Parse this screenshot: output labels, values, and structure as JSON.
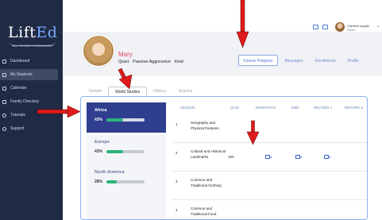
{
  "app": {
    "logo_main": "Lift",
    "logo_accent": "Ed",
    "logo_tagline": "ALL THINGS PARAMOUNT"
  },
  "sidebar": {
    "items": [
      {
        "label": "Dashboard",
        "icon": "grid-icon",
        "active": false
      },
      {
        "label": "My Students",
        "icon": "students-icon",
        "active": true
      },
      {
        "label": "Calendar",
        "icon": "calendar-icon",
        "active": false
      },
      {
        "label": "Family Directory",
        "icon": "family-icon",
        "active": false
      },
      {
        "label": "Tutorials",
        "icon": "info-icon",
        "active": false
      },
      {
        "label": "Support",
        "icon": "support-icon",
        "active": false
      }
    ]
  },
  "topbar": {
    "user_name": "Caroline Ingalls",
    "user_role": "Parent",
    "icons": [
      "chat-icon",
      "book-icon"
    ]
  },
  "student": {
    "name": "Mary",
    "traits": [
      "Quiet",
      "Passive Aggressive",
      "Kind"
    ]
  },
  "profile_tabs": [
    {
      "label": "Course Progress",
      "active": true
    },
    {
      "label": "Messages",
      "active": false
    },
    {
      "label": "Enrollments",
      "active": false
    },
    {
      "label": "Profile",
      "active": false
    }
  ],
  "subject_tabs": [
    {
      "label": "Growth",
      "active": false
    },
    {
      "label": "World Studies",
      "active": true
    },
    {
      "label": "History",
      "active": false
    },
    {
      "label": "Science",
      "active": false
    }
  ],
  "regions": [
    {
      "name": "Africa",
      "percent_label": "43%",
      "progress": 0.43,
      "active": true
    },
    {
      "name": "Europe",
      "percent_label": "43%",
      "progress": 0.43,
      "active": false
    },
    {
      "name": "North America",
      "percent_label": "28%",
      "progress": 0.28,
      "active": false
    }
  ],
  "lesson_table": {
    "headers": {
      "lesson": "LESSON",
      "quiz": "QUIZ",
      "research": "RESEARCH",
      "rr": "R&R",
      "record1": "RECORD 1",
      "record2": "RECORD 2"
    },
    "rows": [
      {
        "num": "1",
        "lesson": "Geography and Physical Features",
        "quiz": "",
        "research": false,
        "rr": false,
        "record1": false
      },
      {
        "num": "2",
        "lesson": "Cultural and Historical Landmarks",
        "quiz": "100",
        "research": true,
        "rr": true,
        "record1": true
      },
      {
        "num": "3",
        "lesson": "Common and Traditional Clothing",
        "quiz": "",
        "research": false,
        "rr": false,
        "record1": false
      },
      {
        "num": "4",
        "lesson": "Common and Traditional Food",
        "quiz": "",
        "research": false,
        "rr": false,
        "record1": false
      }
    ]
  },
  "colors": {
    "sidebar_bg": "#1f2a44",
    "accent_blue": "#2f3e8f",
    "progress_green": "#2ab57a",
    "student_name": "#e1456b",
    "annotation_red": "#e01b1b"
  }
}
